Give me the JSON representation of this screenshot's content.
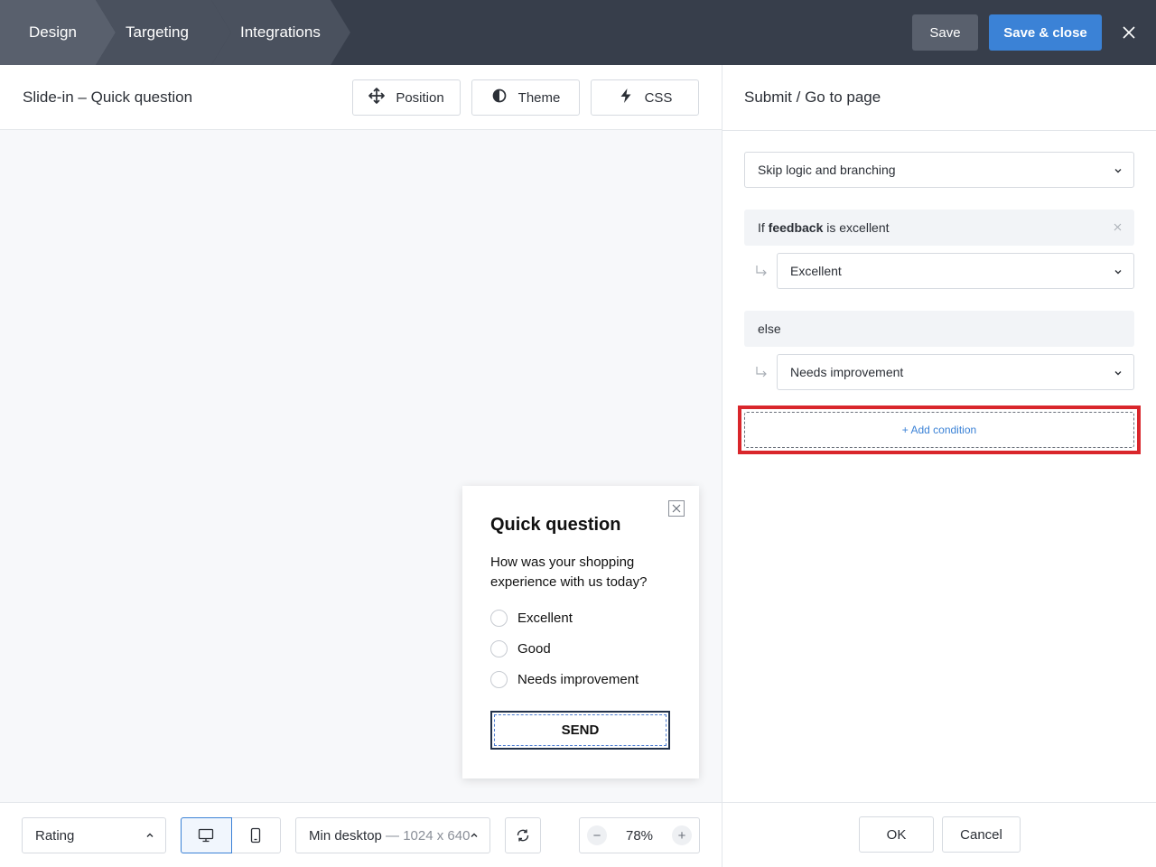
{
  "header": {
    "steps": [
      "Design",
      "Targeting",
      "Integrations"
    ],
    "save_label": "Save",
    "save_close_label": "Save & close",
    "close_icon": "close-icon"
  },
  "editor": {
    "title": "Slide-in – Quick question",
    "tools": [
      {
        "label": "Position",
        "icon": "move-icon"
      },
      {
        "label": "Theme",
        "icon": "contrast-icon"
      },
      {
        "label": "CSS",
        "icon": "lightning-icon"
      }
    ]
  },
  "popup": {
    "title": "Quick question",
    "question": "How was your shopping experience with us today?",
    "options": [
      "Excellent",
      "Good",
      "Needs improvement"
    ],
    "send_label": "SEND"
  },
  "footer": {
    "field_type": "Rating",
    "devices": [
      "desktop-icon",
      "mobile-icon"
    ],
    "active_device": "desktop",
    "viewport_label": "Min desktop",
    "viewport_size": "— 1024 x 640",
    "zoom": "78%",
    "zoom_minus": "−",
    "zoom_plus": "+"
  },
  "panel": {
    "title": "Submit / Go to page",
    "logic_select": "Skip logic and branching",
    "condition_prefix": "If ",
    "condition_field": "feedback",
    "condition_suffix": " is excellent",
    "condition_target": "Excellent",
    "else_label": "else",
    "else_target": "Needs improvement",
    "add_condition": "+ Add condition",
    "ok_label": "OK",
    "cancel_label": "Cancel"
  },
  "colors": {
    "topbar": "#373e4b",
    "primary": "#3b82d6",
    "highlight": "#d9262b"
  }
}
